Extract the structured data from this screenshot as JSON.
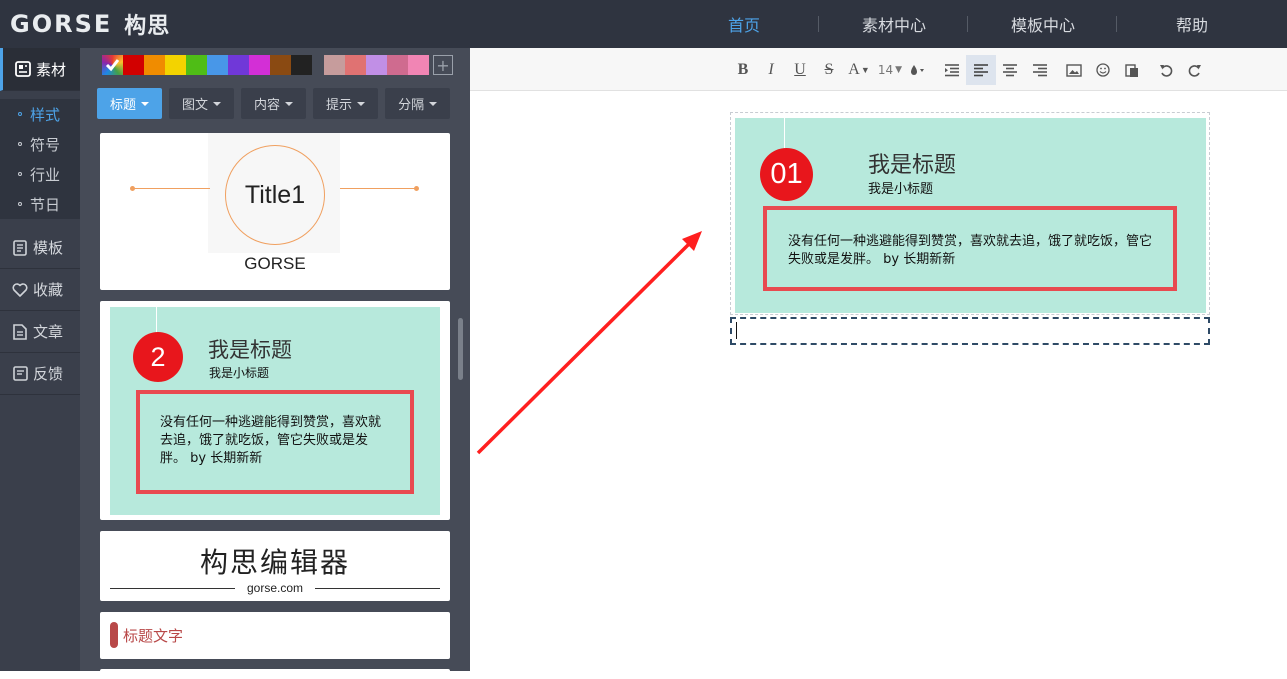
{
  "topbar": {
    "brand": "GORSE",
    "brand_cn": "构思",
    "nav": [
      {
        "label": "首页",
        "active": true
      },
      {
        "label": "素材中心",
        "active": false
      },
      {
        "label": "模板中心",
        "active": false
      },
      {
        "label": "帮助",
        "active": false
      }
    ]
  },
  "leftnav": {
    "items": [
      {
        "label": "素材",
        "icon": "material-icon"
      },
      {
        "label": "模板",
        "icon": "template-icon"
      },
      {
        "label": "收藏",
        "icon": "heart-icon"
      },
      {
        "label": "文章",
        "icon": "article-icon"
      },
      {
        "label": "反馈",
        "icon": "feedback-icon"
      }
    ],
    "sub_items": [
      {
        "label": "样式",
        "active": true
      },
      {
        "label": "符号",
        "active": false
      },
      {
        "label": "行业",
        "active": false
      },
      {
        "label": "节日",
        "active": false
      }
    ]
  },
  "panel": {
    "swatches": [
      "#d20000",
      "#f08c00",
      "#f3d300",
      "#4fbd16",
      "#4897e8",
      "#7038d8",
      "#d32fd6",
      "#8a4a12",
      "#222222"
    ],
    "swatches_light": [
      "#c69c9c",
      "#e07272",
      "#c18fe6",
      "#cf6b8f",
      "#f185b4"
    ],
    "tabs": [
      {
        "label": "标题",
        "active": true
      },
      {
        "label": "图文",
        "active": false
      },
      {
        "label": "内容",
        "active": false
      },
      {
        "label": "提示",
        "active": false
      },
      {
        "label": "分隔",
        "active": false
      }
    ],
    "card1": {
      "title": "Title1",
      "subtitle": "GORSE"
    },
    "card2": {
      "number": "2",
      "title": "我是标题",
      "subtitle": "我是小标题",
      "body": "没有任何一种逃避能得到赞赏，喜欢就去追，饿了就吃饭，管它失败或是发胖。 by 长期新新"
    },
    "card3": {
      "title": "构思编辑器",
      "url": "gorse.com"
    },
    "card4": {
      "label": "标题文字"
    }
  },
  "toolbar": {
    "font_size": "14"
  },
  "editor": {
    "number": "01",
    "title": "我是标题",
    "subtitle": "我是小标题",
    "body": "没有任何一种逃避能得到赞赏，喜欢就去追，饿了就吃饭，管它失败或是发胖。 by 长期新新"
  },
  "colors": {
    "accent": "#4da3e8",
    "teal": "#b7e9dc",
    "red": "#e8161c",
    "arrow": "#ff1f1f"
  }
}
